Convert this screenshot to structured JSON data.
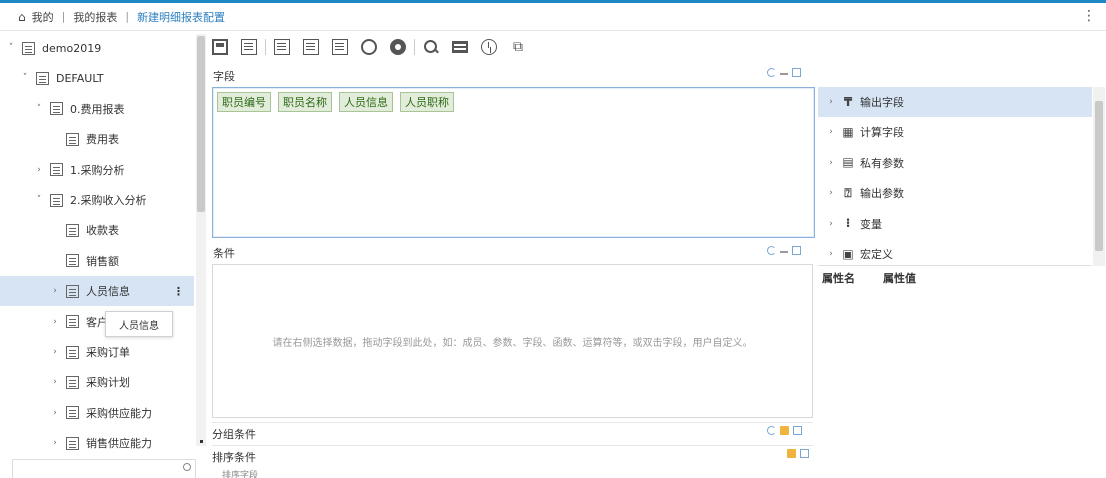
{
  "breadcrumb": {
    "items": [
      "我的",
      "我的报表"
    ],
    "current": "新建明细报表配置"
  },
  "tree": {
    "rows": [
      {
        "label": "demo2019",
        "indent": 0,
        "expand": "open"
      },
      {
        "label": "DEFAULT",
        "indent": 1,
        "expand": "open"
      },
      {
        "label": "0.费用报表",
        "indent": 2,
        "expand": "open"
      },
      {
        "label": "费用表",
        "indent": 3,
        "expand": "none"
      },
      {
        "label": "1.采购分析",
        "indent": 2,
        "expand": "closed"
      },
      {
        "label": "2.采购收入分析",
        "indent": 2,
        "expand": "open"
      },
      {
        "label": "收款表",
        "indent": 3,
        "expand": "none"
      },
      {
        "label": "销售额",
        "indent": 3,
        "expand": "none"
      },
      {
        "label": "人员信息",
        "indent": 3,
        "expand": "closed",
        "selected": true
      },
      {
        "label": "客户信息",
        "indent": 3,
        "expand": "closed"
      },
      {
        "label": "采购订单",
        "indent": 3,
        "expand": "closed"
      },
      {
        "label": "采购计划",
        "indent": 3,
        "expand": "closed"
      },
      {
        "label": "采购供应能力",
        "indent": 3,
        "expand": "closed"
      },
      {
        "label": "销售供应能力",
        "indent": 3,
        "expand": "closed"
      }
    ],
    "tooltip": "人员信息",
    "kebab": "⋮"
  },
  "panels": {
    "fields_title": "字段",
    "fields_chips": [
      "职员编号",
      "职员名称",
      "人员信息",
      "人员职称"
    ],
    "condition_title": "条件",
    "condition_hint": "请在右侧选择数据，拖动字段到此处，如：成员、参数、字段、函数、运算符等，或双击字段，用户自定义。",
    "group_title": "分组条件",
    "sort_title": "排序条件",
    "sort_sub": "排序字段"
  },
  "right_panel": {
    "rows": [
      {
        "label": "输出字段",
        "icon": "filter-icon",
        "selected": true
      },
      {
        "label": "计算字段",
        "icon": "calc-icon"
      },
      {
        "label": "私有参数",
        "icon": "param-icon"
      },
      {
        "label": "输出参数",
        "icon": "output-param-icon"
      },
      {
        "label": "变量",
        "icon": "variable-icon"
      },
      {
        "label": "宏定义",
        "icon": "macro-icon"
      }
    ],
    "param_headers": [
      "属性名",
      "属性值"
    ]
  },
  "colors": {
    "accent": "#1e88c7",
    "selection": "#d6e4f4",
    "chip_bg": "#e2ecda",
    "chip_text": "#2e6b16"
  }
}
